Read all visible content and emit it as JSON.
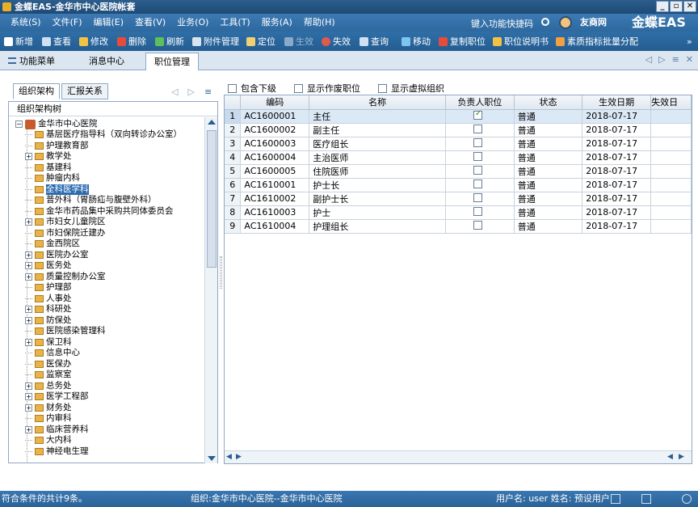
{
  "window": {
    "title": "金蝶EAS-金华市中心医院帐套",
    "btn_min": "_",
    "btn_max": "▫",
    "btn_close": "✕"
  },
  "menu": [
    "系统(S)",
    "文件(F)",
    "编辑(E)",
    "查看(V)",
    "业务(O)",
    "工具(T)",
    "服务(A)",
    "帮助(H)"
  ],
  "header": {
    "quick_key": "键入功能快捷码",
    "brand_small": "友商网",
    "brand_big": "金蝶EAS"
  },
  "toolbar": {
    "add": "新增",
    "view": "查看",
    "edit": "修改",
    "delete": "删除",
    "refresh": "刷新",
    "attachment": "附件管理",
    "locate": "定位",
    "enable": "生效",
    "disable": "失效",
    "query": "查询",
    "move": "移动",
    "copy_position": "复制职位",
    "position_desc": "职位说明书",
    "quality_assign": "素质指标批量分配"
  },
  "main_tabs": [
    "功能菜单",
    "消息中心",
    "职位管理"
  ],
  "left": {
    "subtabs": [
      "组织架构",
      "汇报关系"
    ],
    "tree_header": "组织架构树",
    "root": "金华市中心医院",
    "nodes": [
      {
        "label": "基层医疗指导科（双向转诊办公室）",
        "expand": false
      },
      {
        "label": "护理教育部",
        "expand": false
      },
      {
        "label": "教学处",
        "expand": true
      },
      {
        "label": "基建科",
        "expand": false
      },
      {
        "label": "肿瘤内科",
        "expand": false
      },
      {
        "label": "全科医学科",
        "expand": false,
        "selected": true
      },
      {
        "label": "普外科（胃肠疝与腹壁外科）",
        "expand": false
      },
      {
        "label": "金华市药品集中采购共同体委员会",
        "expand": false
      },
      {
        "label": "市妇女儿童院区",
        "expand": true
      },
      {
        "label": "市妇保院迁建办",
        "expand": false
      },
      {
        "label": "金西院区",
        "expand": false
      },
      {
        "label": "医院办公室",
        "expand": true
      },
      {
        "label": "医务处",
        "expand": true
      },
      {
        "label": "质量控制办公室",
        "expand": true
      },
      {
        "label": "护理部",
        "expand": false
      },
      {
        "label": "人事处",
        "expand": false
      },
      {
        "label": "科研处",
        "expand": true
      },
      {
        "label": "防保处",
        "expand": true
      },
      {
        "label": "医院感染管理科",
        "expand": false
      },
      {
        "label": "保卫科",
        "expand": true
      },
      {
        "label": "信息中心",
        "expand": false
      },
      {
        "label": "医保办",
        "expand": false
      },
      {
        "label": "监察室",
        "expand": false
      },
      {
        "label": "总务处",
        "expand": true
      },
      {
        "label": "医学工程部",
        "expand": true
      },
      {
        "label": "财务处",
        "expand": true
      },
      {
        "label": "内审科",
        "expand": false
      },
      {
        "label": "临床营养科",
        "expand": true
      },
      {
        "label": "大内科",
        "expand": false
      },
      {
        "label": "神经电生理",
        "expand": false
      }
    ]
  },
  "filters": [
    "包含下级",
    "显示作废职位",
    "显示虚拟组织"
  ],
  "grid": {
    "columns": [
      "编码",
      "名称",
      "负责人职位",
      "状态",
      "生效日期",
      "失效日"
    ],
    "rows": [
      {
        "no": "1",
        "code": "AC1600001",
        "name": "主任",
        "leader": true,
        "status": "普通",
        "date": "2018-07-17"
      },
      {
        "no": "2",
        "code": "AC1600002",
        "name": "副主任",
        "leader": false,
        "status": "普通",
        "date": "2018-07-17"
      },
      {
        "no": "3",
        "code": "AC1600003",
        "name": "医疗组长",
        "leader": false,
        "status": "普通",
        "date": "2018-07-17"
      },
      {
        "no": "4",
        "code": "AC1600004",
        "name": "主治医师",
        "leader": false,
        "status": "普通",
        "date": "2018-07-17"
      },
      {
        "no": "5",
        "code": "AC1600005",
        "name": "住院医师",
        "leader": false,
        "status": "普通",
        "date": "2018-07-17"
      },
      {
        "no": "6",
        "code": "AC1610001",
        "name": "护士长",
        "leader": false,
        "status": "普通",
        "date": "2018-07-17"
      },
      {
        "no": "7",
        "code": "AC1610002",
        "name": "副护士长",
        "leader": false,
        "status": "普通",
        "date": "2018-07-17"
      },
      {
        "no": "8",
        "code": "AC1610003",
        "name": "护士",
        "leader": false,
        "status": "普通",
        "date": "2018-07-17"
      },
      {
        "no": "9",
        "code": "AC1610004",
        "name": "护理组长",
        "leader": false,
        "status": "普通",
        "date": "2018-07-17"
      }
    ]
  },
  "status": {
    "count": "符合条件的共计9条。",
    "org": "组织:金华市中心医院--金华市中心医院",
    "user": "用户名: user  姓名: 预设用户"
  }
}
